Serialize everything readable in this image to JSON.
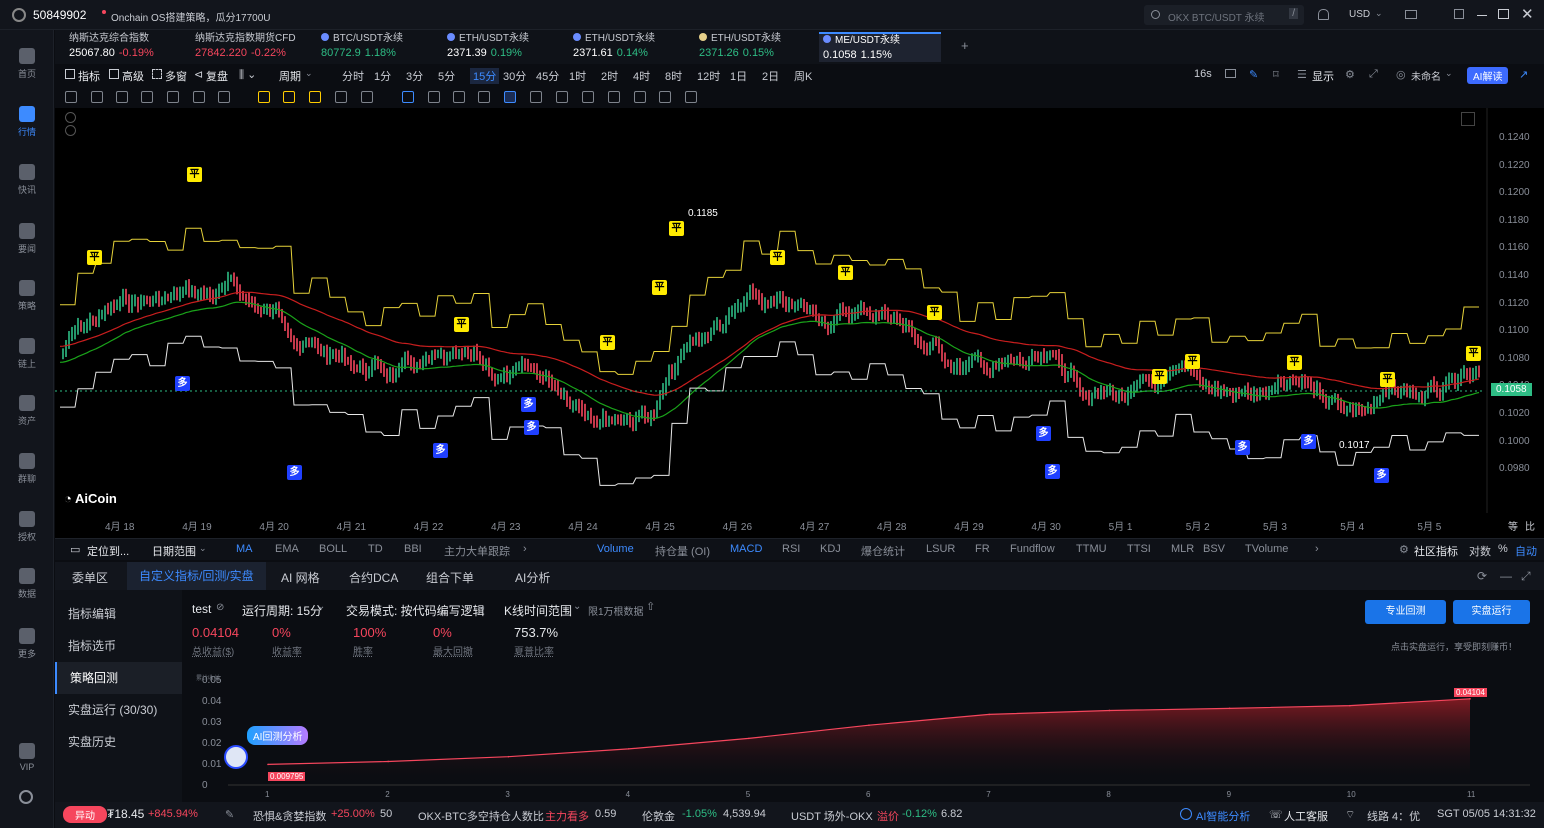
{
  "topbar": {
    "account": "50849902",
    "headline": "Onchain OS搭建策略，瓜分17700U",
    "search_placeholder": "OKX BTC/USDT 永续",
    "currency": "USD",
    "search_key": "/"
  },
  "sidebar": {
    "items": [
      {
        "label": "首页",
        "icon": "home-icon"
      },
      {
        "label": "行情",
        "icon": "chart-bars-icon"
      },
      {
        "label": "快讯",
        "icon": "news-flash-icon"
      },
      {
        "label": "要闻",
        "icon": "document-icon"
      },
      {
        "label": "策略",
        "icon": "robot-icon"
      },
      {
        "label": "链上",
        "icon": "chain-icon"
      },
      {
        "label": "资产",
        "icon": "wallet-icon"
      },
      {
        "label": "群聊",
        "icon": "chat-icon"
      },
      {
        "label": "授权",
        "icon": "auth-icon"
      },
      {
        "label": "数据",
        "icon": "data-icon"
      },
      {
        "label": "更多",
        "icon": "grid-icon"
      },
      {
        "label": "VIP",
        "icon": "vip-icon"
      }
    ]
  },
  "tickers": [
    {
      "name": "纳斯达克综合指数",
      "price": "25067.80",
      "change": "-0.19%",
      "dir": "dn"
    },
    {
      "name": "纳斯达克指数期货CFD",
      "price": "27842.220",
      "change": "-0.22%",
      "dir": "dn"
    },
    {
      "name": "BTC/USDT永续",
      "price": "80772.9",
      "change": "1.18%",
      "dir": "up"
    },
    {
      "name": "ETH/USDT永续",
      "price": "2371.39",
      "change": "0.19%",
      "dir": "up"
    },
    {
      "name": "ETH/USDT永续",
      "price": "2371.61",
      "change": "0.14%",
      "dir": "up"
    },
    {
      "name": "ETH/USDT永续",
      "price": "2371.26",
      "change": "0.15%",
      "dir": "up"
    },
    {
      "name": "ME/USDT永续",
      "price": "0.1058",
      "change": "1.15%",
      "dir": "up"
    }
  ],
  "toolbar1": {
    "indicators": "指标",
    "advanced": "高级",
    "multi": "多窗",
    "replay": "复盘",
    "period": "周期",
    "intervals": [
      "分时",
      "1分",
      "3分",
      "5分",
      "15分",
      "30分",
      "45分",
      "1时",
      "2时",
      "4时",
      "8时",
      "12时",
      "1日",
      "2日",
      "周K"
    ],
    "active_interval": "15分",
    "countdown": "16s",
    "display": "显示",
    "unnamed": "未命名",
    "ai_read": "AI解读"
  },
  "chart": {
    "price_axis": [
      "0.1240",
      "0.1220",
      "0.1200",
      "0.1180",
      "0.1160",
      "0.1140",
      "0.1120",
      "0.1100",
      "0.1080",
      "0.1058",
      "0.1040",
      "0.1020",
      "0.1000",
      "0.0980"
    ],
    "current_price": "0.1058",
    "high_label": "0.1185",
    "low_label": "0.1017",
    "date_axis": [
      "4月 18",
      "4月 19",
      "4月 20",
      "4月 21",
      "4月 22",
      "4月 23",
      "4月 24",
      "4月 25",
      "4月 26",
      "4月 27",
      "4月 28",
      "4月 29",
      "4月 30",
      "5月 1",
      "5月 2",
      "5月 3",
      "5月 4",
      "5月 5"
    ],
    "axis_right": [
      "等",
      "比"
    ],
    "logo": "AiCoin",
    "marker_flat": "平",
    "marker_long": "多"
  },
  "indbar": {
    "locate": "定位到...",
    "date_range": "日期范围",
    "main_inds": [
      "MA",
      "EMA",
      "BOLL",
      "TD",
      "BBI",
      "主力大单跟踪"
    ],
    "sub_inds": [
      "Volume",
      "持仓量 (OI)",
      "MACD",
      "RSI",
      "KDJ",
      "爆仓统计",
      "LSUR",
      "FR",
      "Fundflow",
      "TTMU",
      "TTSI",
      "MLR",
      "BSV",
      "TVolume"
    ],
    "community": "社区指标",
    "compare": "对数",
    "percent": "%",
    "auto": "自动"
  },
  "tabs": [
    "委单区",
    "自定义指标/回测/实盘",
    "AI 网格",
    "合约DCA",
    "组合下单",
    "AI分析"
  ],
  "active_tab": "自定义指标/回测/实盘",
  "leftnav": [
    "指标编辑",
    "指标选币",
    "策略回测",
    "实盘运行 (30/30)",
    "实盘历史"
  ],
  "active_leftnav": "策略回测",
  "backtest": {
    "name": "test",
    "period": "运行周期: 15分",
    "mode": "交易模式: 按代码编写逻辑",
    "kline_range": "K线时间范围",
    "limit": "限1万根数据",
    "stats": [
      {
        "value": "0.04104",
        "label": "总收益($)",
        "color": "red"
      },
      {
        "value": "0%",
        "label": "收益率",
        "color": "red"
      },
      {
        "value": "100%",
        "label": "胜率",
        "color": "red"
      },
      {
        "value": "0%",
        "label": "最大回撤",
        "color": "red"
      },
      {
        "value": "753.7%",
        "label": "夏普比率",
        "color": "white"
      }
    ],
    "pro_btn": "专业回测",
    "live_btn": "实盘运行",
    "hint": "点击实盘运行，享受即刻赚币！",
    "ai_btn": "AI回测分析",
    "y_axis_title": "累计收益",
    "y_axis": [
      "0.05",
      "0.04",
      "0.03",
      "0.02",
      "0.01",
      "0"
    ],
    "x_axis": [
      "1",
      "2",
      "3",
      "4",
      "5",
      "6",
      "7",
      "8",
      "9",
      "10",
      "11"
    ],
    "start_label": "0.009795",
    "end_label": "0.04104"
  },
  "chart_data": {
    "type": "area",
    "title": "",
    "xlabel": "",
    "ylabel": "累计收益",
    "x": [
      1,
      2,
      3,
      4,
      5,
      6,
      7,
      8,
      9,
      10,
      11
    ],
    "values": [
      0.009795,
      0.0112,
      0.0135,
      0.0172,
      0.0222,
      0.0285,
      0.0336,
      0.0355,
      0.0365,
      0.0378,
      0.04104
    ],
    "ylim": [
      0,
      0.05
    ]
  },
  "bottombar": {
    "alert": "异动",
    "price": "₮18.45",
    "chg": "+845.94%",
    "fear_label": "恐惧&贪婪指数",
    "fear_chg": "+25.00%",
    "fear_val": "50",
    "okx_label": "OKX-BTC多空持仓人数比",
    "okx_tag": "主力看多",
    "okx_val": "0.59",
    "gold_label": "伦敦金",
    "gold_chg": "-1.05%",
    "gold_val": "4,539.94",
    "usdt_label": "USDT 场外-OKX",
    "usdt_tag": "溢价",
    "usdt_chg": "-0.12%",
    "usdt_val": "6.82",
    "ai_smart": "AI智能分析",
    "support": "人工客服",
    "line": "线路 4：优",
    "time": "SGT 05/05 14:31:32"
  }
}
